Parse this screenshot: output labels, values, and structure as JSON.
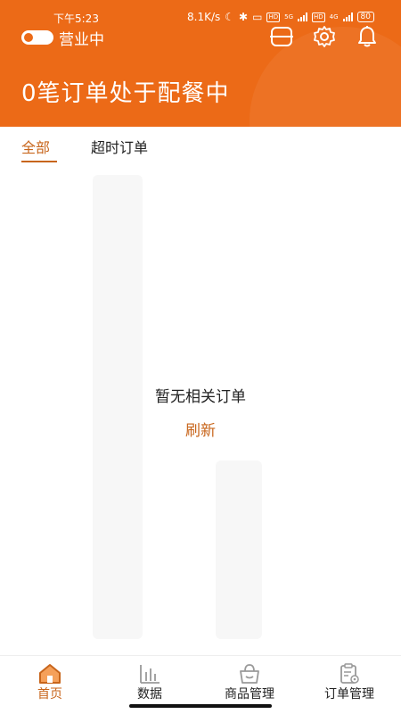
{
  "status_bar": {
    "time": "下午5:23",
    "speed": "8.1K/s",
    "network_1": "5G",
    "network_2": "4G",
    "battery": "80"
  },
  "header": {
    "business_status": "营业中",
    "business_open": true,
    "headline": "0笔订单处于配餐中",
    "accent_color": "#ec6a17",
    "icons": [
      "scan-icon",
      "gear-icon",
      "bell-icon"
    ]
  },
  "tabs": [
    {
      "label": "全部",
      "active": true
    },
    {
      "label": "超时订单",
      "active": false
    }
  ],
  "empty_state": {
    "message": "暂无相关订单",
    "refresh_label": "刷新"
  },
  "bottom_nav": [
    {
      "label": "首页",
      "icon": "home-icon",
      "active": true
    },
    {
      "label": "数据",
      "icon": "chart-icon",
      "active": false
    },
    {
      "label": "商品管理",
      "icon": "basket-icon",
      "active": false
    },
    {
      "label": "订单管理",
      "icon": "order-settings-icon",
      "active": false
    }
  ]
}
